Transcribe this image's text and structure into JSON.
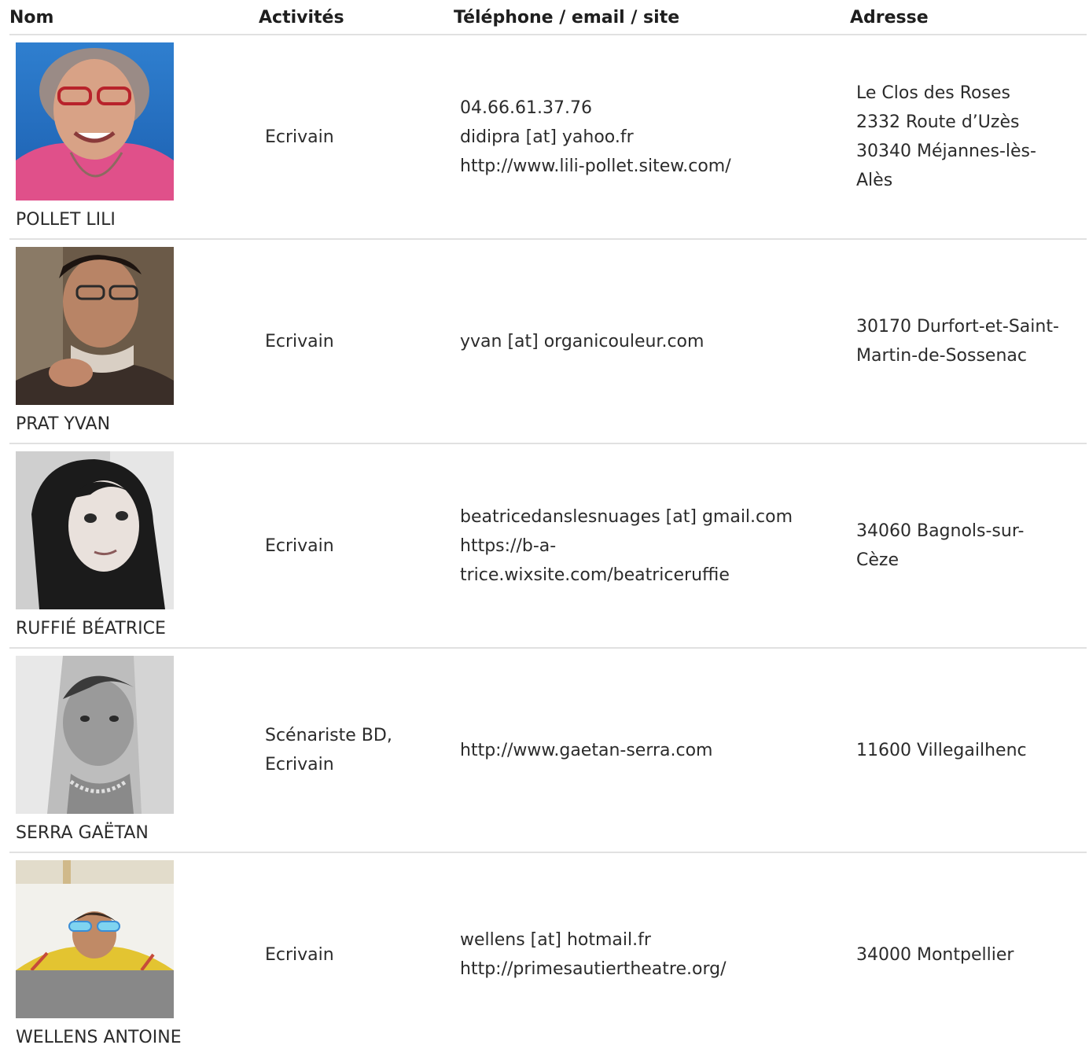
{
  "headers": {
    "name": "Nom",
    "activities": "Activités",
    "contact": "Téléphone / email / site",
    "address": "Adresse"
  },
  "rows": [
    {
      "photo_icon": "portrait-photo",
      "name": "POLLET LILI",
      "activities": [
        "Ecrivain"
      ],
      "contact": [
        "04.66.61.37.76",
        "didipra [at] yahoo.fr",
        "http://www.lili-pollet.sitew.com/"
      ],
      "address": [
        "Le Clos des Roses",
        "2332 Route d’Uzès",
        "30340 Méjannes-lès-",
        "Alès"
      ]
    },
    {
      "photo_icon": "portrait-photo",
      "name": "PRAT YVAN",
      "activities": [
        "Ecrivain"
      ],
      "contact": [
        "yvan [at] organicouleur.com"
      ],
      "address": [
        "30170 Durfort-et-Saint-",
        "Martin-de-Sossenac"
      ]
    },
    {
      "photo_icon": "portrait-photo",
      "name": "RUFFIÉ BÉATRICE",
      "activities": [
        "Ecrivain"
      ],
      "contact": [
        "beatricedanslesnuages [at] gmail.com",
        "https://b-a-",
        "trice.wixsite.com/beatriceruffie"
      ],
      "address": [
        "34060 Bagnols-sur-",
        "Cèze"
      ]
    },
    {
      "photo_icon": "portrait-photo",
      "name": "SERRA GAËTAN",
      "activities": [
        "Scénariste BD,",
        "Ecrivain"
      ],
      "contact": [
        "http://www.gaetan-serra.com"
      ],
      "address": [
        "11600 Villegailhenc"
      ]
    },
    {
      "photo_icon": "portrait-photo",
      "name": "WELLENS ANTOINE",
      "activities": [
        "Ecrivain"
      ],
      "contact": [
        "wellens [at] hotmail.fr",
        "http://primesautiertheatre.org/"
      ],
      "address": [
        "34000 Montpellier"
      ]
    }
  ]
}
